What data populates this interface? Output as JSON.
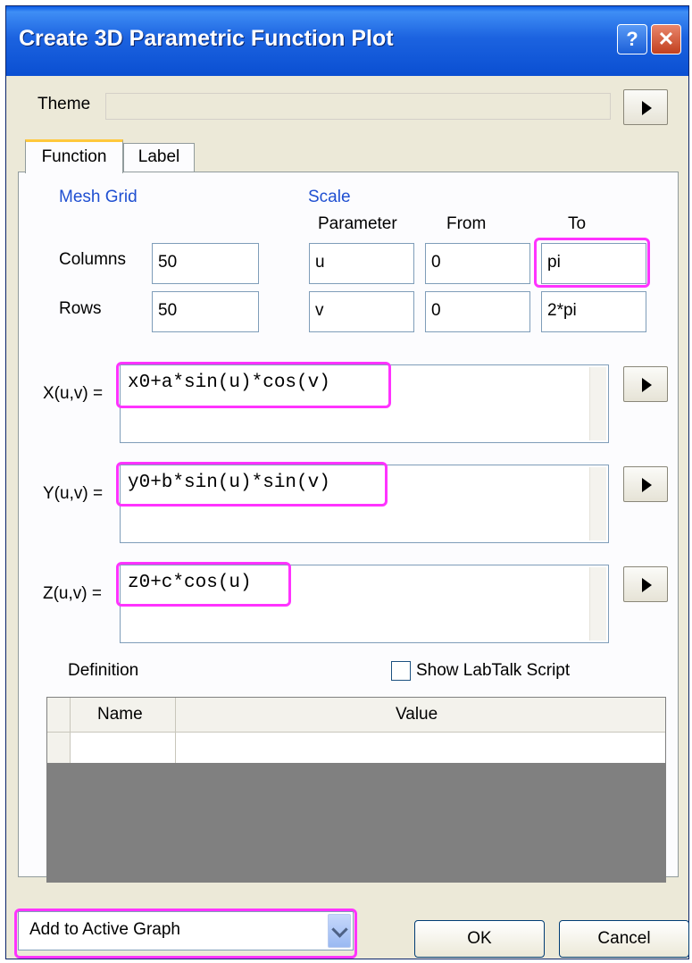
{
  "window": {
    "title": "Create 3D Parametric Function Plot",
    "help_glyph": "?",
    "close_glyph": "✕"
  },
  "theme": {
    "label": "Theme",
    "value": ""
  },
  "tabs": [
    {
      "label": "Function"
    },
    {
      "label": "Label"
    }
  ],
  "mesh_grid": {
    "heading": "Mesh Grid",
    "columns_label": "Columns",
    "columns_value": "50",
    "rows_label": "Rows",
    "rows_value": "50"
  },
  "scale": {
    "heading": "Scale",
    "col_headers": {
      "parameter": "Parameter",
      "from": "From",
      "to": "To"
    },
    "rows": [
      {
        "parameter": "u",
        "from": "0",
        "to": "pi"
      },
      {
        "parameter": "v",
        "from": "0",
        "to": "2*pi"
      }
    ]
  },
  "functions": {
    "x": {
      "label": "X(u,v) =",
      "expr": "x0+a*sin(u)*cos(v)"
    },
    "y": {
      "label": "Y(u,v) =",
      "expr": "y0+b*sin(u)*sin(v)"
    },
    "z": {
      "label": "Z(u,v) =",
      "expr": "z0+c*cos(u)"
    }
  },
  "definition": {
    "label": "Definition",
    "show_labtalk_label": "Show LabTalk Script",
    "show_labtalk_checked": false,
    "columns": [
      "Name",
      "Value"
    ],
    "rows": [
      {
        "name": "",
        "value": ""
      }
    ]
  },
  "footer": {
    "output_select": "Add to Active Graph",
    "ok_label": "OK",
    "cancel_label": "Cancel"
  },
  "colors": {
    "highlight": "#ff33ff",
    "title_bar": "#1c63e0",
    "heading_blue": "#1f4fd1"
  }
}
